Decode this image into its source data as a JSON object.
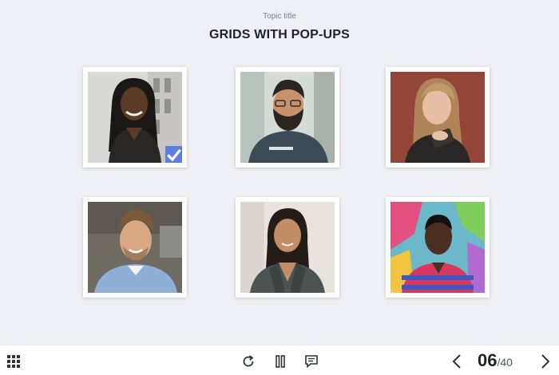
{
  "header": {
    "topic": "Topic title",
    "title": "GRIDS WITH POP-UPS"
  },
  "grid": {
    "cards": [
      {
        "name": "person-1",
        "selected": true
      },
      {
        "name": "person-2",
        "selected": false
      },
      {
        "name": "person-3",
        "selected": false
      },
      {
        "name": "person-4",
        "selected": false
      },
      {
        "name": "person-5",
        "selected": false
      },
      {
        "name": "person-6",
        "selected": false
      }
    ],
    "accent_color": "#5b7fe0"
  },
  "player": {
    "current": "06",
    "total": "/40",
    "icons": [
      "grid-menu-icon",
      "reload-icon",
      "pause-icon",
      "notes-icon",
      "chevron-left-icon",
      "chevron-right-icon"
    ]
  }
}
